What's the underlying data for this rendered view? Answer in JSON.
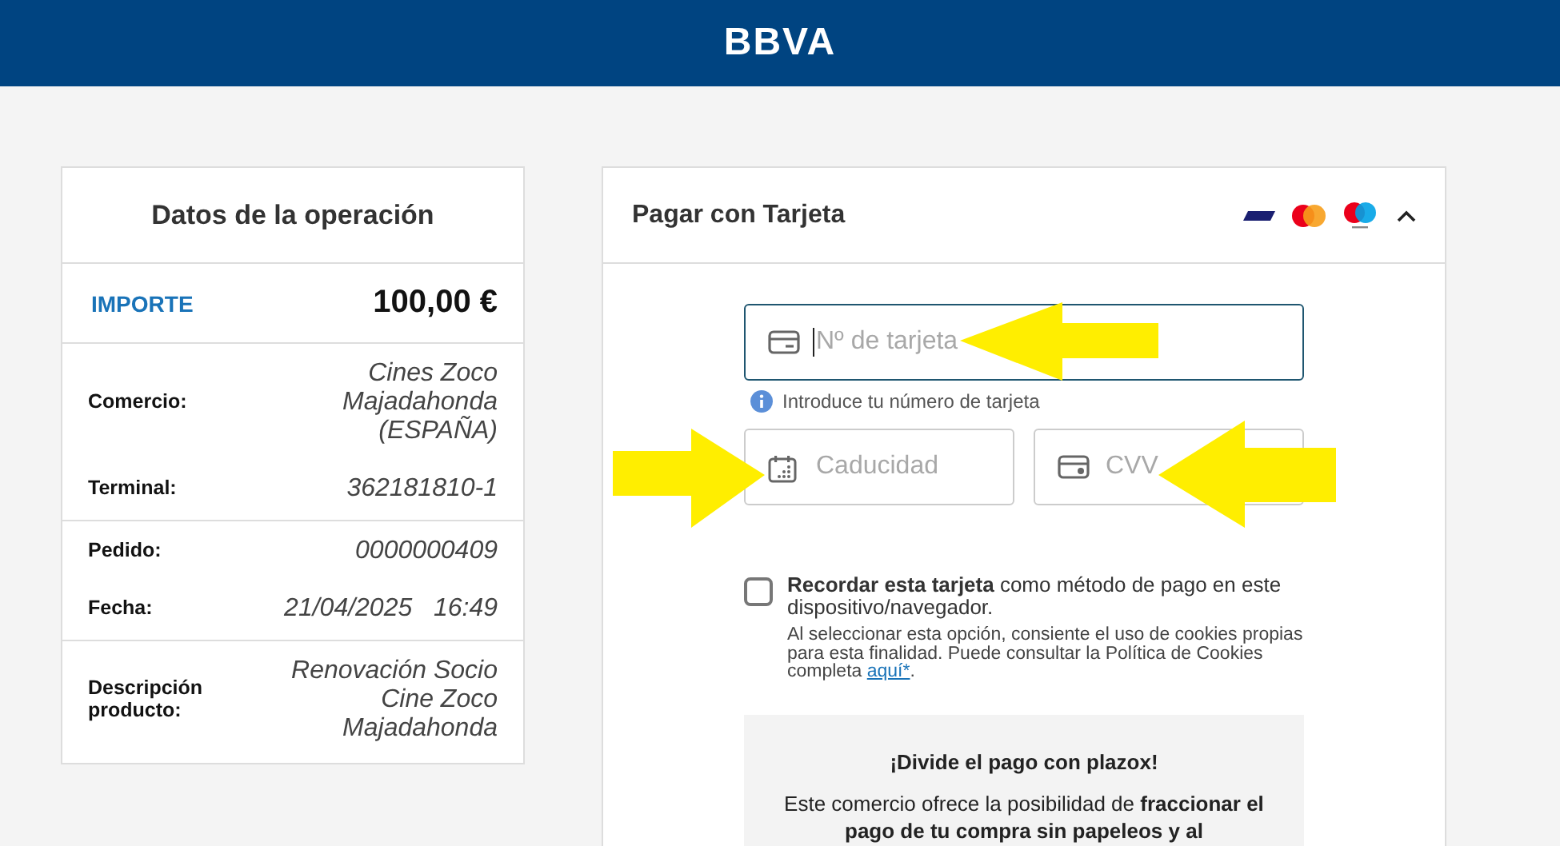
{
  "header": {
    "logo": "BBVA"
  },
  "operation": {
    "title": "Datos de la operación",
    "amount_label": "IMPORTE",
    "amount": "100,00 €",
    "groups": [
      [
        {
          "label": "Comercio:",
          "value": "Cines Zoco Majadahonda (ESPAÑA)"
        },
        {
          "label": "Terminal:",
          "value": "362181810-1"
        }
      ],
      [
        {
          "label": "Pedido:",
          "value": "0000000409"
        },
        {
          "label": "Fecha:",
          "value": "21/04/2025   16:49"
        }
      ],
      [
        {
          "label": "Descripción producto:",
          "value": "Renovación Socio Cine Zoco Majadahonda"
        }
      ]
    ]
  },
  "payment": {
    "title": "Pagar con Tarjeta",
    "expanded": true,
    "fields": [
      {
        "kind": "card",
        "placeholder": "Nº de tarjeta",
        "focused": true
      },
      {
        "kind": "date",
        "placeholder": "Caducidad",
        "focused": false
      },
      {
        "kind": "cvv",
        "placeholder": "CVV",
        "focused": false
      }
    ],
    "hint": "Introduce tu número de tarjeta",
    "remember": {
      "checked": false,
      "label": "**Recordar esta tarjeta** como método de pago en este dispositivo/navegador.",
      "note": "Al seleccionar esta opción, consiente el uso de cookies propias para esta finalidad. Puede consultar la Política de Cookies completa",
      "link": "aquí*",
      "note_end": "."
    },
    "plazox": {
      "title": "¡Divide el pago con plazox!",
      "text": "Este comercio ofrece la posibilidad de **fraccionar el pago de tu compra sin papeleos y al**"
    }
  }
}
